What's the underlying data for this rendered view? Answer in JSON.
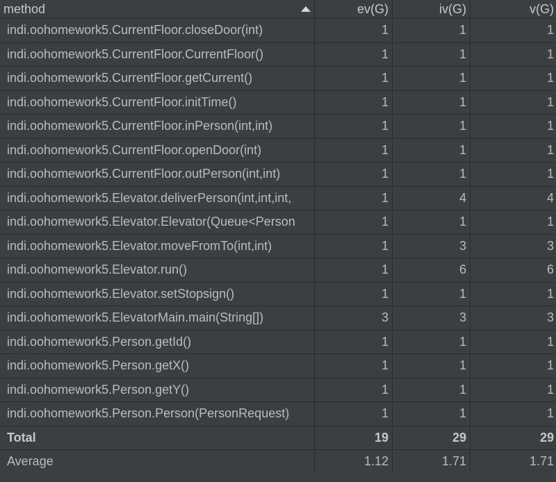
{
  "table": {
    "columns": [
      "method",
      "ev(G)",
      "iv(G)",
      "v(G)"
    ],
    "sort": {
      "column": "method",
      "direction": "ascending"
    },
    "rows": [
      {
        "method": "indi.oohomework5.CurrentFloor.closeDoor(int)",
        "ev": "1",
        "iv": "1",
        "v": "1"
      },
      {
        "method": "indi.oohomework5.CurrentFloor.CurrentFloor()",
        "ev": "1",
        "iv": "1",
        "v": "1"
      },
      {
        "method": "indi.oohomework5.CurrentFloor.getCurrent()",
        "ev": "1",
        "iv": "1",
        "v": "1"
      },
      {
        "method": "indi.oohomework5.CurrentFloor.initTime()",
        "ev": "1",
        "iv": "1",
        "v": "1"
      },
      {
        "method": "indi.oohomework5.CurrentFloor.inPerson(int,int)",
        "ev": "1",
        "iv": "1",
        "v": "1"
      },
      {
        "method": "indi.oohomework5.CurrentFloor.openDoor(int)",
        "ev": "1",
        "iv": "1",
        "v": "1"
      },
      {
        "method": "indi.oohomework5.CurrentFloor.outPerson(int,int)",
        "ev": "1",
        "iv": "1",
        "v": "1"
      },
      {
        "method": "indi.oohomework5.Elevator.deliverPerson(int,int,int,",
        "ev": "1",
        "iv": "4",
        "v": "4"
      },
      {
        "method": "indi.oohomework5.Elevator.Elevator(Queue<Person",
        "ev": "1",
        "iv": "1",
        "v": "1"
      },
      {
        "method": "indi.oohomework5.Elevator.moveFromTo(int,int)",
        "ev": "1",
        "iv": "3",
        "v": "3"
      },
      {
        "method": "indi.oohomework5.Elevator.run()",
        "ev": "1",
        "iv": "6",
        "v": "6"
      },
      {
        "method": "indi.oohomework5.Elevator.setStopsign()",
        "ev": "1",
        "iv": "1",
        "v": "1"
      },
      {
        "method": "indi.oohomework5.ElevatorMain.main(String[])",
        "ev": "3",
        "iv": "3",
        "v": "3"
      },
      {
        "method": "indi.oohomework5.Person.getId()",
        "ev": "1",
        "iv": "1",
        "v": "1"
      },
      {
        "method": "indi.oohomework5.Person.getX()",
        "ev": "1",
        "iv": "1",
        "v": "1"
      },
      {
        "method": "indi.oohomework5.Person.getY()",
        "ev": "1",
        "iv": "1",
        "v": "1"
      },
      {
        "method": "indi.oohomework5.Person.Person(PersonRequest)",
        "ev": "1",
        "iv": "1",
        "v": "1"
      }
    ],
    "total": {
      "label": "Total",
      "ev": "19",
      "iv": "29",
      "v": "29"
    },
    "average": {
      "label": "Average",
      "ev": "1.12",
      "iv": "1.71",
      "v": "1.71"
    }
  },
  "colors": {
    "background": "#3c3f41",
    "grid": "#2b2b2b",
    "text": "#bbbbbb"
  }
}
